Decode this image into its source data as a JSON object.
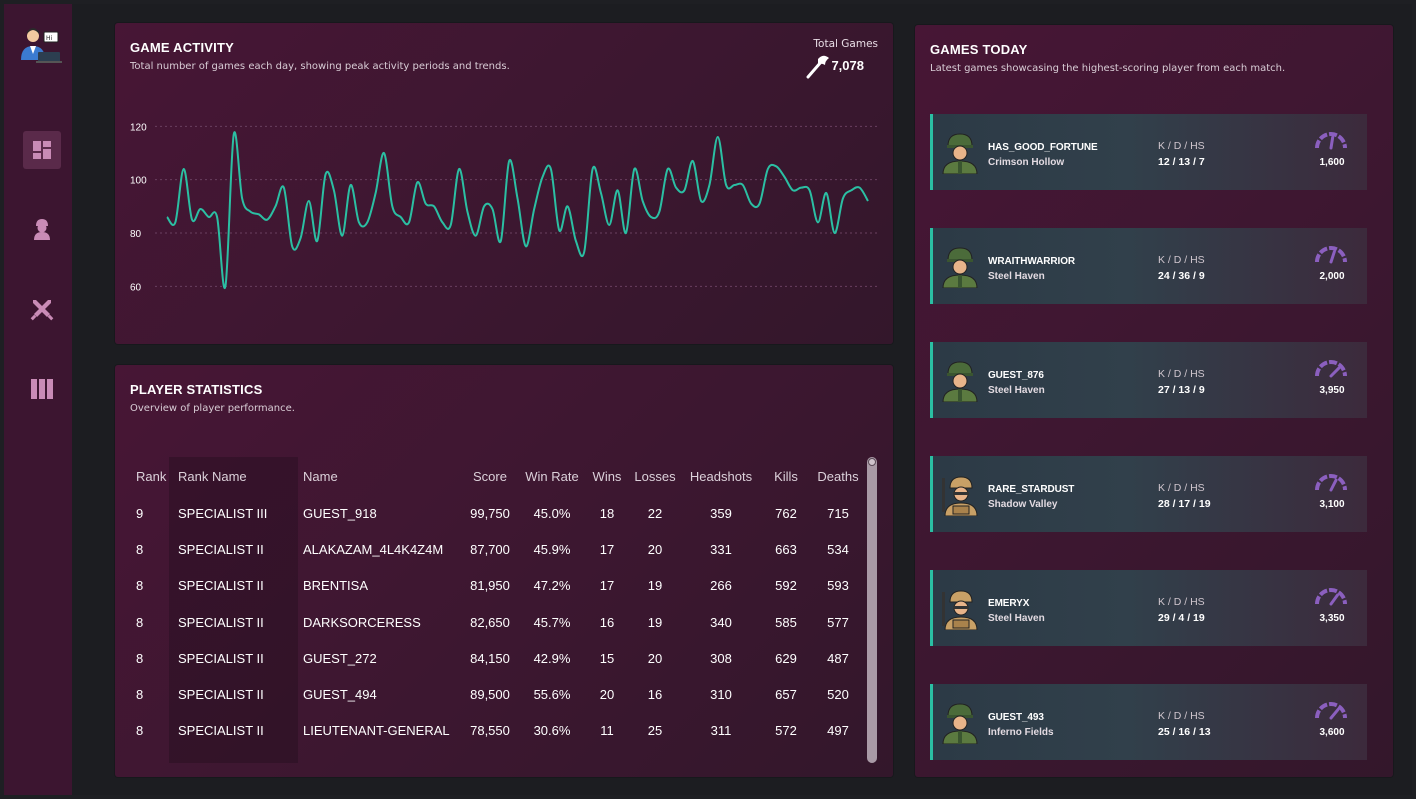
{
  "colors": {
    "accent_line": "#2bbfa3",
    "gauge": "#8b5fbf",
    "nav_icon": "#c98bb6"
  },
  "sidebar": {
    "logo": "user-laptop-icon",
    "items": [
      {
        "icon": "dashboard-icon",
        "active": true
      },
      {
        "icon": "soldier-icon",
        "active": false
      },
      {
        "icon": "crossed-swords-icon",
        "active": false
      },
      {
        "icon": "columns-icon",
        "active": false
      }
    ]
  },
  "activity": {
    "title": "GAME ACTIVITY",
    "subtitle": "Total number of games each day, showing peak activity periods and trends.",
    "total_label": "Total Games",
    "total_value": "7,078",
    "total_icon": "axe-icon"
  },
  "chart_data": {
    "type": "line",
    "title": "",
    "xlabel": "",
    "ylabel": "",
    "ylim": [
      50,
      125
    ],
    "yticks": [
      60,
      80,
      100,
      120
    ],
    "grid": true,
    "series": [
      {
        "values": [
          86,
          84,
          104,
          85,
          89,
          86,
          86,
          60,
          117,
          93,
          88,
          87,
          85,
          90,
          97,
          75,
          78,
          92,
          77,
          102,
          96,
          79,
          98,
          84,
          84,
          95,
          110,
          90,
          86,
          84,
          99,
          91,
          90,
          84,
          83,
          104,
          88,
          79,
          90,
          89,
          77,
          107,
          93,
          75,
          89,
          101,
          104,
          81,
          90,
          77,
          73,
          104,
          95,
          83,
          96,
          80,
          104,
          92,
          86,
          88,
          104,
          97,
          96,
          107,
          92,
          98,
          116,
          98,
          98,
          98,
          91,
          91,
          104,
          105,
          101,
          96,
          97,
          96,
          84,
          95,
          80,
          93,
          96,
          97,
          92
        ]
      }
    ]
  },
  "stats": {
    "title": "PLAYER STATISTICS",
    "subtitle": "Overview of player performance.",
    "columns": [
      "Rank",
      "Rank Name",
      "Name",
      "Score",
      "Win Rate",
      "Wins",
      "Losses",
      "Headshots",
      "Kills",
      "Deaths"
    ],
    "rows": [
      [
        "9",
        "SPECIALIST III",
        "GUEST_918",
        "99,750",
        "45.0%",
        "18",
        "22",
        "359",
        "762",
        "715"
      ],
      [
        "8",
        "SPECIALIST II",
        "ALAKAZAM_4L4K4Z4M",
        "87,700",
        "45.9%",
        "17",
        "20",
        "331",
        "663",
        "534"
      ],
      [
        "8",
        "SPECIALIST II",
        "BRENTISA",
        "81,950",
        "47.2%",
        "17",
        "19",
        "266",
        "592",
        "593"
      ],
      [
        "8",
        "SPECIALIST II",
        "DARKSORCERESS",
        "82,650",
        "45.7%",
        "16",
        "19",
        "340",
        "585",
        "577"
      ],
      [
        "8",
        "SPECIALIST II",
        "GUEST_272",
        "84,150",
        "42.9%",
        "15",
        "20",
        "308",
        "629",
        "487"
      ],
      [
        "8",
        "SPECIALIST II",
        "GUEST_494",
        "89,500",
        "55.6%",
        "20",
        "16",
        "310",
        "657",
        "520"
      ],
      [
        "8",
        "SPECIALIST II",
        "LIEUTENANT-GENERAL",
        "78,550",
        "30.6%",
        "11",
        "25",
        "311",
        "572",
        "497"
      ]
    ]
  },
  "today": {
    "title": "GAMES TODAY",
    "subtitle": "Latest games showcasing the highest-scoring player from each match.",
    "kdh_label": "K / D / HS",
    "cards": [
      {
        "name": "HAS_GOOD_FORTUNE",
        "map": "Crimson Hollow",
        "stats": "12 / 13 / 7",
        "score": "1,600",
        "avatar": "soldier-helmet-icon",
        "gauge": 0.55
      },
      {
        "name": "WRAITHWARRIOR",
        "map": "Steel Haven",
        "stats": "24 / 36 / 9",
        "score": "2,000",
        "avatar": "soldier-helmet-icon",
        "gauge": 0.6
      },
      {
        "name": "GUEST_876",
        "map": "Steel Haven",
        "stats": "27 / 13 / 9",
        "score": "3,950",
        "avatar": "soldier-helmet-icon",
        "gauge": 0.75
      },
      {
        "name": "RARE_STARDUST",
        "map": "Shadow Valley",
        "stats": "28 / 17 / 19",
        "score": "3,100",
        "avatar": "soldier-rifle-icon",
        "gauge": 0.65
      },
      {
        "name": "EMERYX",
        "map": "Steel Haven",
        "stats": "29 / 4 / 19",
        "score": "3,350",
        "avatar": "soldier-rifle-icon",
        "gauge": 0.7
      },
      {
        "name": "GUEST_493",
        "map": "Inferno Fields",
        "stats": "25 / 16 / 13",
        "score": "3,600",
        "avatar": "soldier-helmet-icon",
        "gauge": 0.72
      }
    ]
  }
}
